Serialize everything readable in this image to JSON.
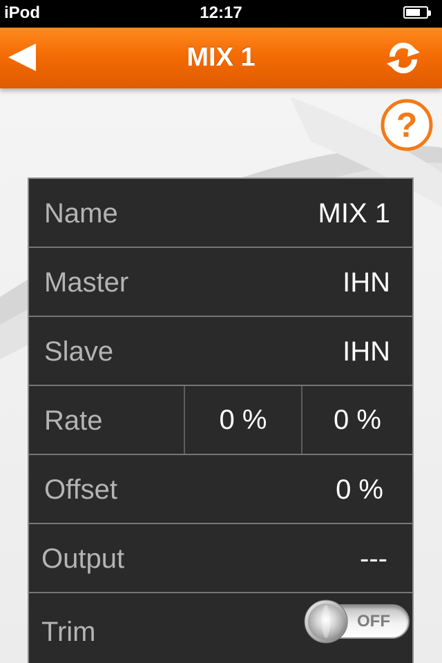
{
  "status_bar": {
    "carrier": "iPod",
    "time": "12:17",
    "battery_level": 0.7
  },
  "nav": {
    "title": "MIX 1",
    "back_icon": "back-arrow-icon",
    "refresh_icon": "refresh-icon"
  },
  "help": {
    "icon": "help-question-icon"
  },
  "settings": {
    "name": {
      "label": "Name",
      "value": "MIX 1"
    },
    "master": {
      "label": "Master",
      "value": "IHN"
    },
    "slave": {
      "label": "Slave",
      "value": "IHN"
    },
    "rate": {
      "label": "Rate",
      "value_1": "0 %",
      "value_2": "0 %"
    },
    "offset": {
      "label": "Offset",
      "value": "0 %"
    },
    "output": {
      "label": "Output",
      "value": "---"
    },
    "trim": {
      "label": "Trim",
      "toggle_label": "OFF",
      "enabled": false
    }
  },
  "colors": {
    "accent": "#f46c04",
    "table_bg": "#2a2a2a",
    "label_text": "#b4b4b4",
    "value_text": "#ffffff"
  }
}
